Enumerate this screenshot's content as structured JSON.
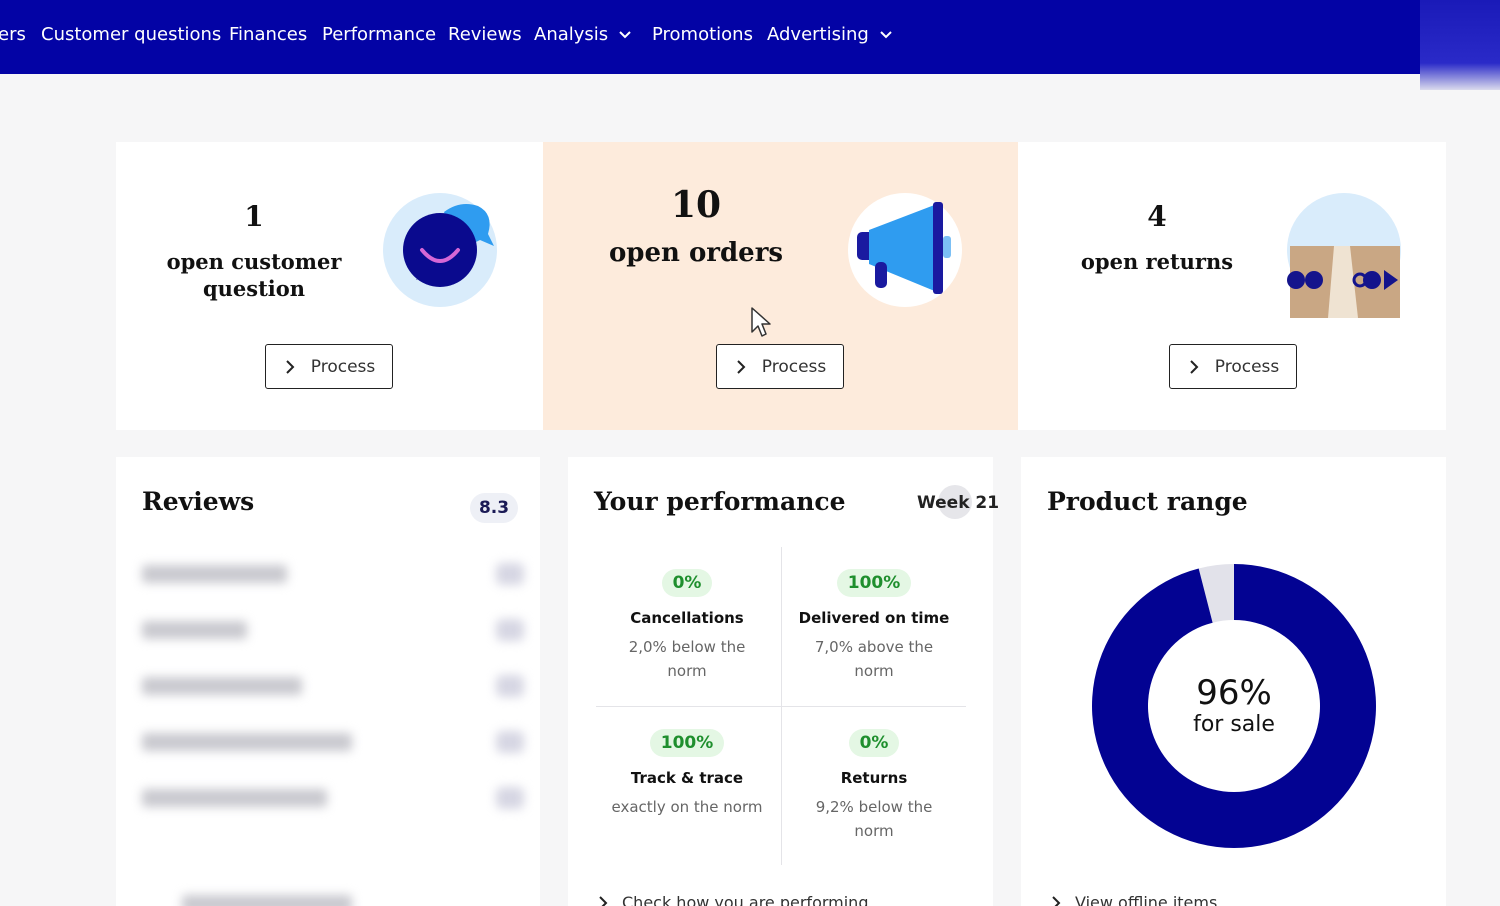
{
  "nav": {
    "items": [
      {
        "label": "ers"
      },
      {
        "label": "Customer questions"
      },
      {
        "label": "Finances"
      },
      {
        "label": "Performance"
      },
      {
        "label": "Reviews"
      },
      {
        "label": "Analysis",
        "has_dropdown": true
      },
      {
        "label": "Promotions"
      },
      {
        "label": "Advertising",
        "has_dropdown": true
      }
    ],
    "background": "#0303a5"
  },
  "summary": {
    "customer_questions": {
      "count": "1",
      "label_line1": "open customer",
      "label_line2": "question",
      "button": "Process",
      "icon": "chat-bubble-icon"
    },
    "orders": {
      "count": "10",
      "label": "open orders",
      "button": "Process",
      "icon": "megaphone-icon",
      "highlight": "#fdebdc"
    },
    "returns": {
      "count": "4",
      "label": "open returns",
      "button": "Process",
      "icon": "returns-box-icon"
    }
  },
  "reviews": {
    "title": "Reviews",
    "score": "8.3"
  },
  "performance": {
    "title": "Your performance",
    "week": "Week 21",
    "metrics": [
      {
        "pct": "0%",
        "name": "Cancellations",
        "desc1": "2,0% below the",
        "desc2": "norm"
      },
      {
        "pct": "100%",
        "name": "Delivered on time",
        "desc1": "7,0% above the",
        "desc2": "norm"
      },
      {
        "pct": "100%",
        "name": "Track & trace",
        "desc1": "exactly on the norm",
        "desc2": ""
      },
      {
        "pct": "0%",
        "name": "Returns",
        "desc1": "9,2% below the",
        "desc2": "norm"
      }
    ],
    "link": "Check how you are performing"
  },
  "product_range": {
    "title": "Product range",
    "percent": "96%",
    "percent_value": 96,
    "caption": "for sale",
    "link": "View offline items",
    "colors": {
      "for_sale": "#030392",
      "offline": "#e2e2ea"
    }
  }
}
